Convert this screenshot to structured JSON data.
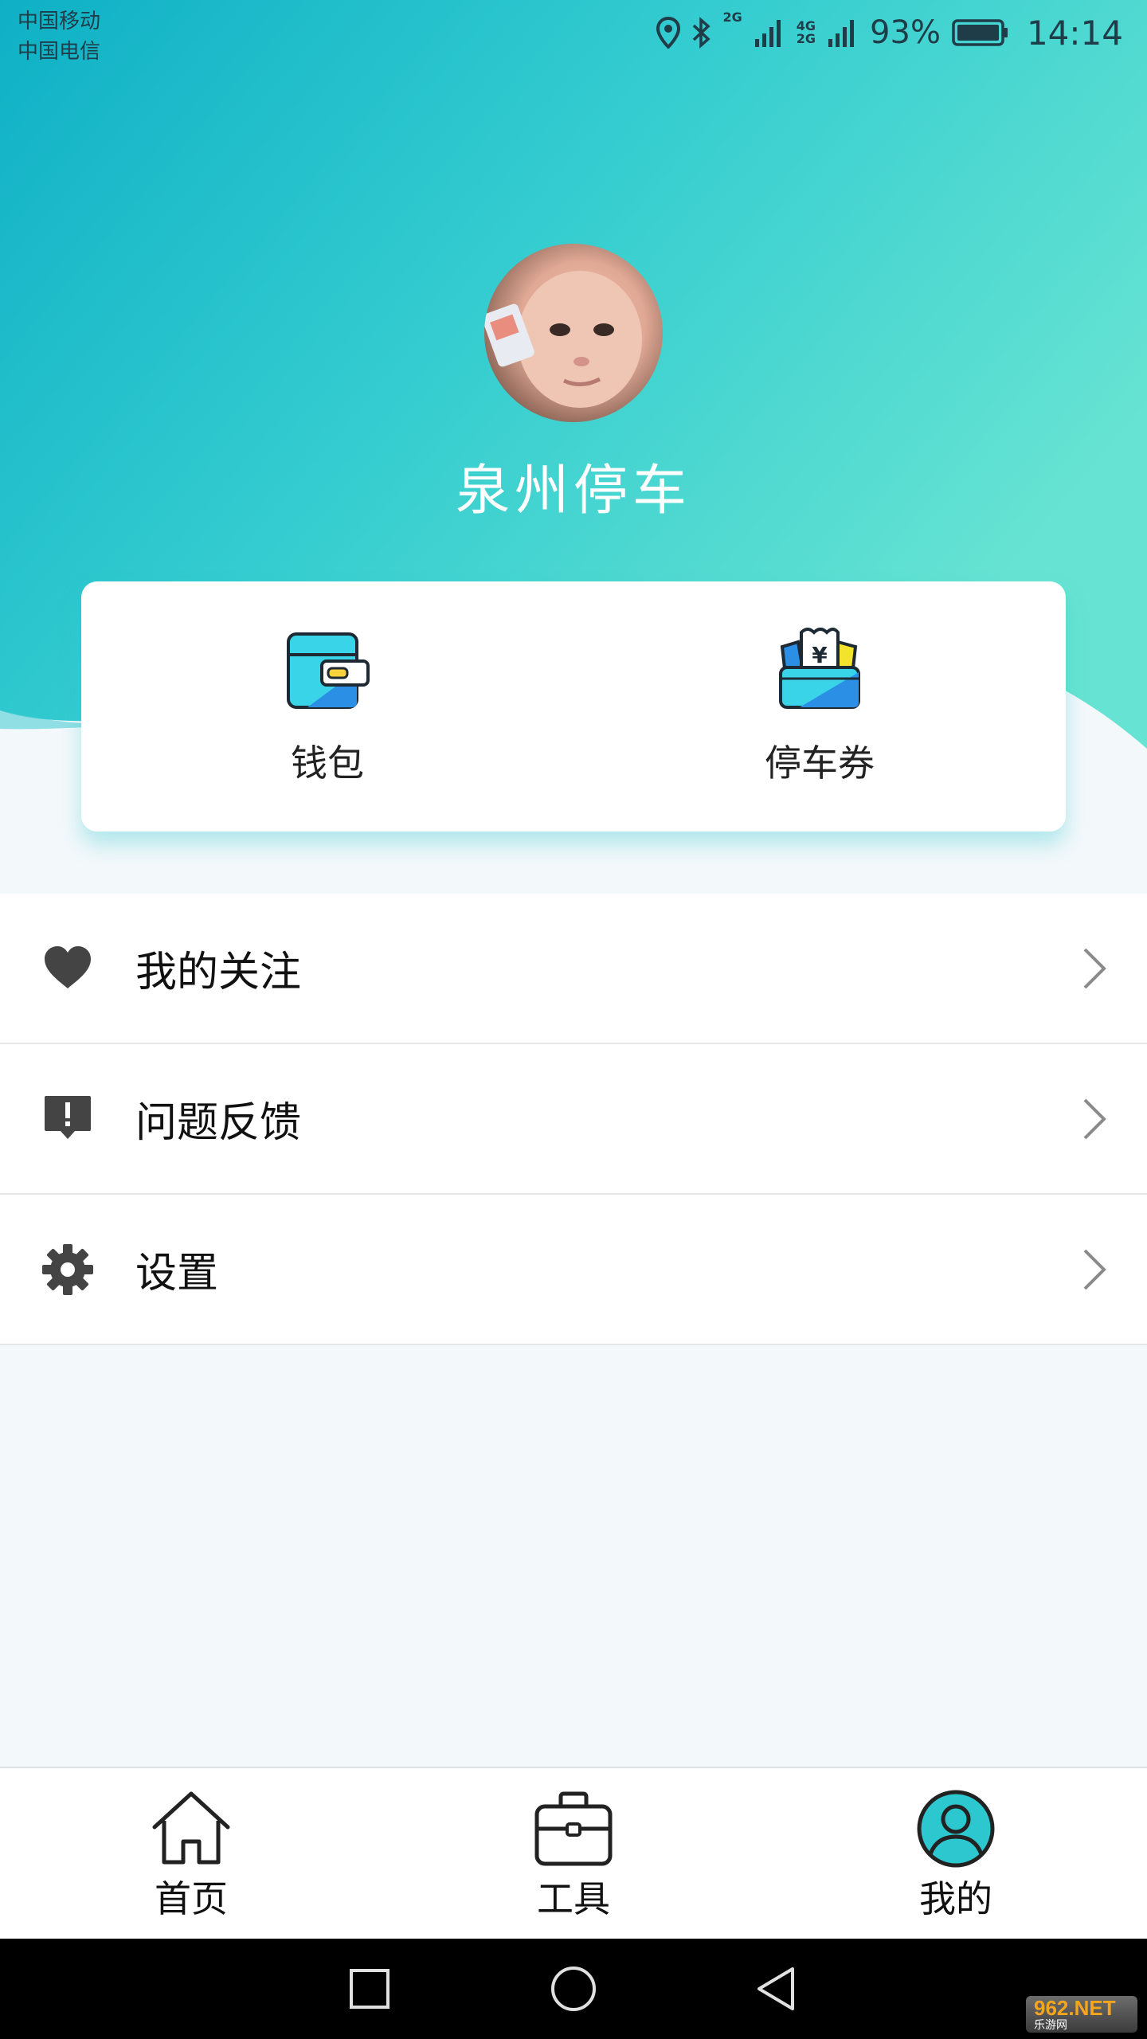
{
  "status_bar": {
    "carrier_1": "中国移动",
    "carrier_2": "中国电信",
    "battery_percent": "93%",
    "time": "14:14",
    "network_1": "2G",
    "network_2": "4G\n2G"
  },
  "profile": {
    "app_name": "泉州停车"
  },
  "quick_actions": [
    {
      "label": "钱包",
      "icon": "wallet-icon"
    },
    {
      "label": "停车券",
      "icon": "parking-coupon-icon"
    }
  ],
  "menu": [
    {
      "label": "我的关注",
      "icon": "heart-icon"
    },
    {
      "label": "问题反馈",
      "icon": "feedback-icon"
    },
    {
      "label": "设置",
      "icon": "gear-icon"
    }
  ],
  "bottom_nav": [
    {
      "label": "首页",
      "icon": "home-icon"
    },
    {
      "label": "工具",
      "icon": "toolbox-icon"
    },
    {
      "label": "我的",
      "icon": "profile-icon",
      "active": true
    }
  ],
  "watermark": {
    "text": "962.NET",
    "sub": "乐游网"
  },
  "colors": {
    "gradient_start": "#14b2c6",
    "gradient_end": "#5fe0d2",
    "icon_dark": "#444444",
    "accent": "#2dc7d0"
  }
}
